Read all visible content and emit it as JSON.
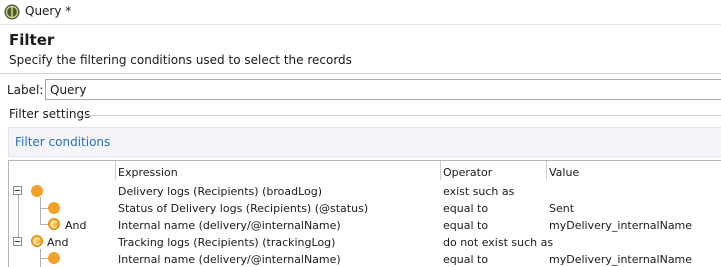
{
  "window": {
    "title": "Query *"
  },
  "page": {
    "title": "Filter",
    "description": "Specify the filtering conditions used to select the records"
  },
  "label_field": {
    "label": "Label:",
    "value": "Query"
  },
  "filter_settings": {
    "title": "Filter settings"
  },
  "filter_conditions": {
    "title": "Filter conditions"
  },
  "grid": {
    "columns": [
      "Expression",
      "Operator",
      "Value"
    ],
    "rows": [
      {
        "logic": "",
        "expression": "Delivery logs (Recipients) (broadLog)",
        "operator": "exist such as",
        "value": ""
      },
      {
        "logic": "",
        "expression": "Status of Delivery logs (Recipients) (@status)",
        "operator": "equal to",
        "value": "Sent"
      },
      {
        "logic": "And",
        "expression": "Internal name (delivery/@internalName)",
        "operator": "equal to",
        "value": "myDelivery_internalName"
      },
      {
        "logic": "And",
        "expression": "Tracking logs (Recipients) (trackingLog)",
        "operator": "do not exist such as",
        "value": ""
      },
      {
        "logic": "",
        "expression": "Internal name (delivery/@internalName)",
        "operator": "equal to",
        "value": "myDelivery_internalName"
      }
    ]
  },
  "colors": {
    "accent": "#2a6ebb",
    "condition_dot": "#f2a12a"
  }
}
